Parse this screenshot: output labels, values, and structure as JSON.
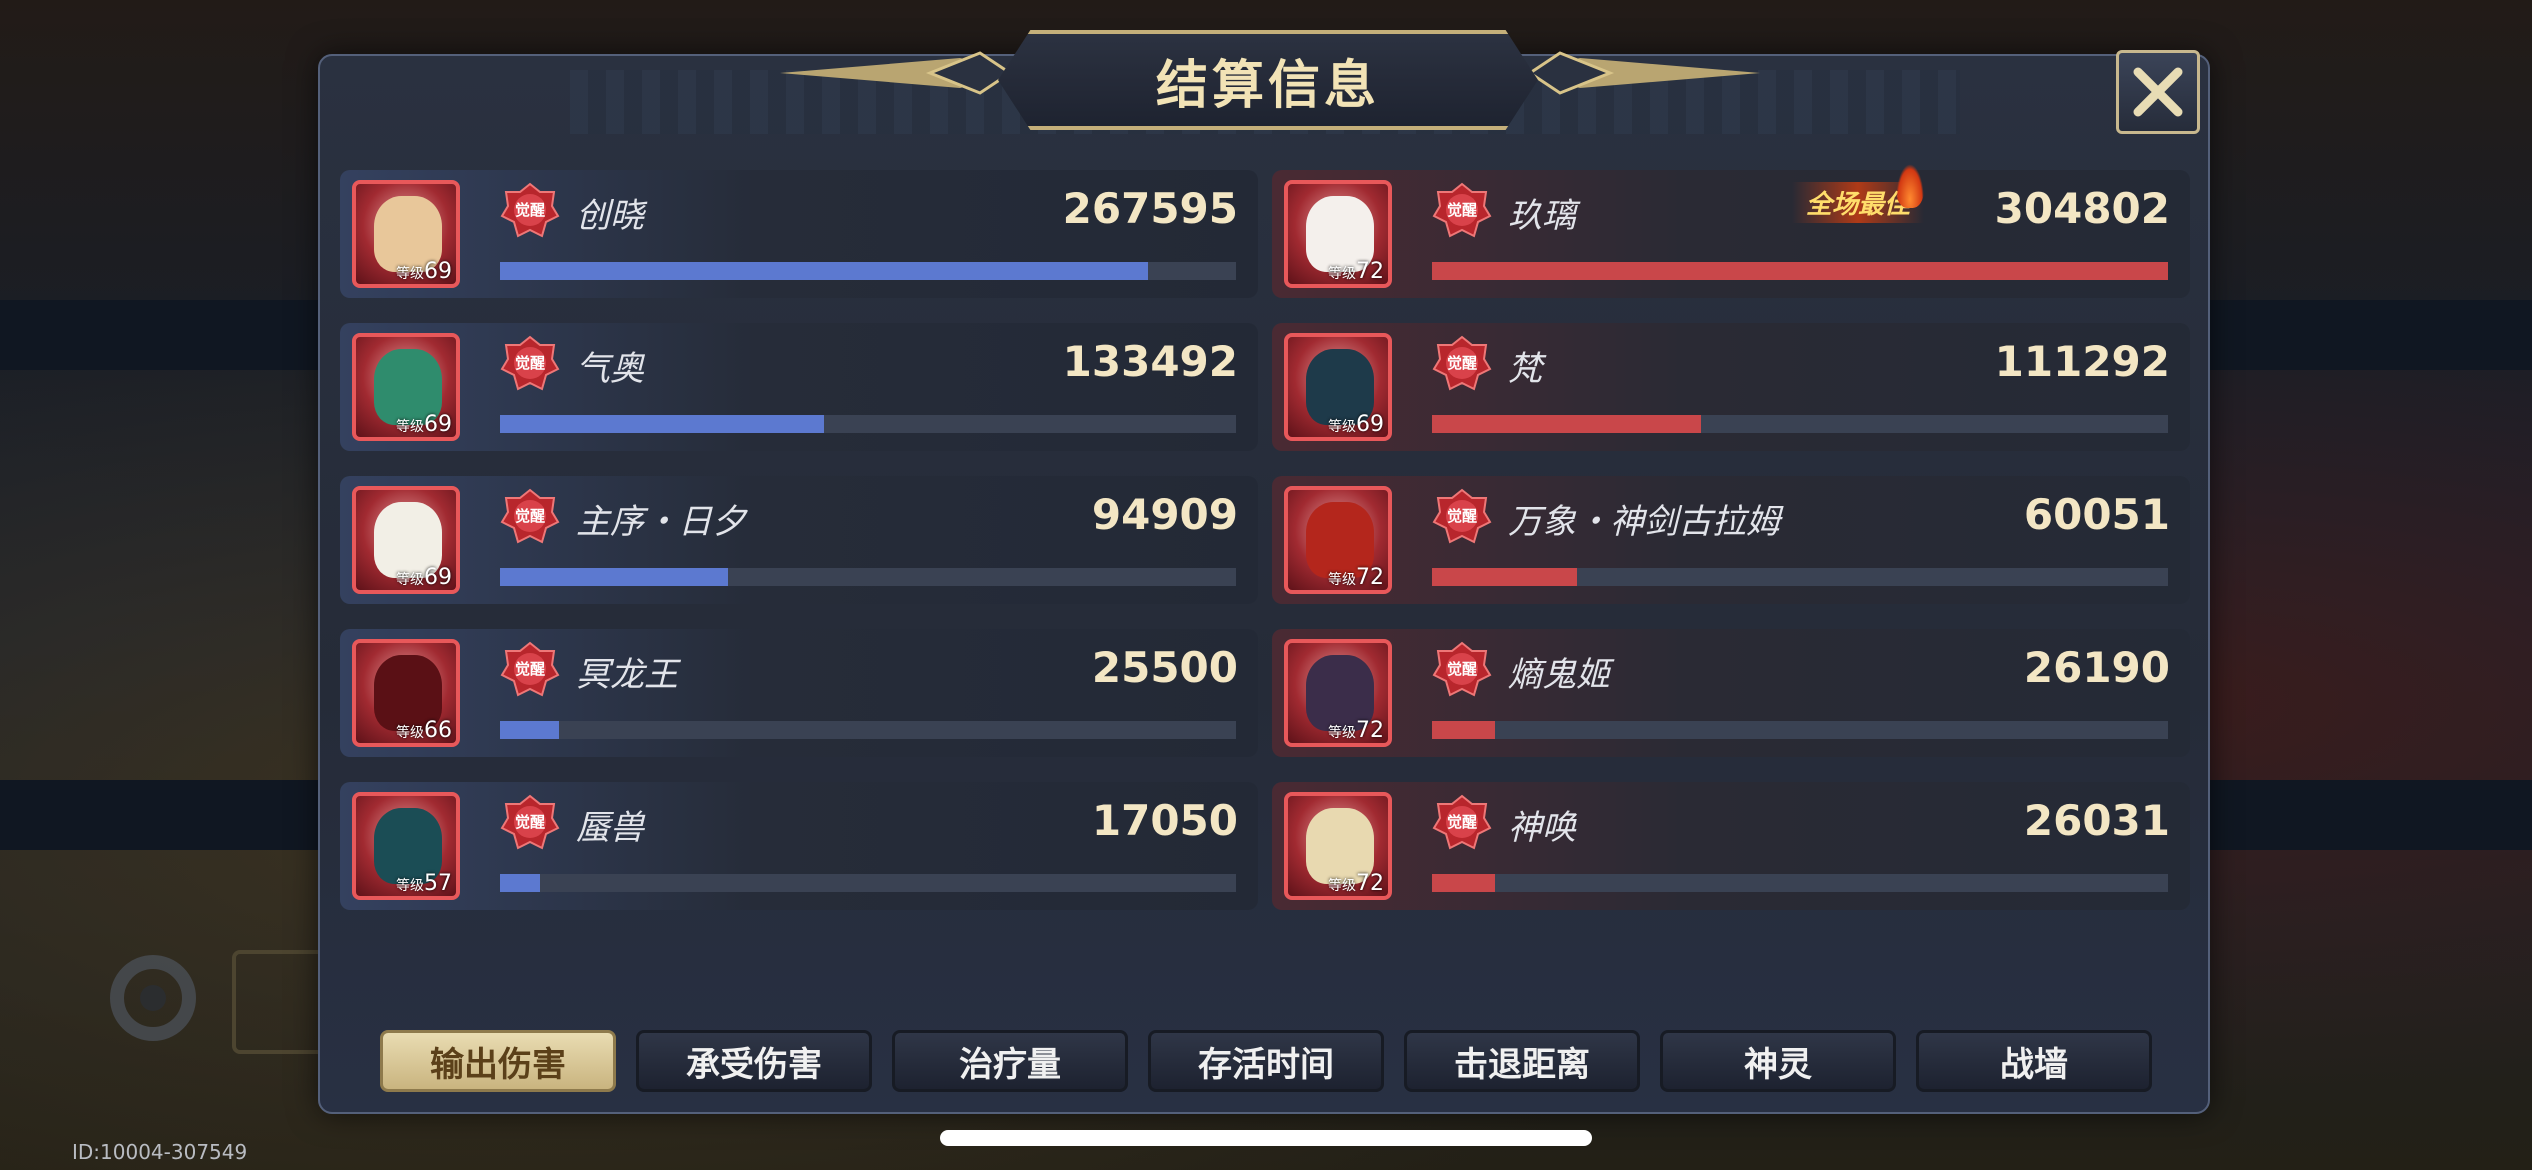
{
  "title": "结算信息",
  "best_label": "全场最佳",
  "awaken_label": "觉醒",
  "level_prefix": "等级",
  "id_text": "ID:10004-307549",
  "colors": {
    "left_bar": "#5c79d0",
    "right_bar": "#c9474a",
    "title_gold": "#f2e3b6"
  },
  "left_team": [
    {
      "name": "创晓",
      "level": "69",
      "score": "267595",
      "ratio": 0.88,
      "hero_color": "#e8c79a"
    },
    {
      "name": "气奥",
      "level": "69",
      "score": "133492",
      "ratio": 0.44,
      "hero_color": "#2f8c6d"
    },
    {
      "name": "主序・日夕",
      "level": "69",
      "score": "94909",
      "ratio": 0.31,
      "hero_color": "#f2efe6"
    },
    {
      "name": "冥龙王",
      "level": "66",
      "score": "25500",
      "ratio": 0.08,
      "hero_color": "#5a1015"
    },
    {
      "name": "蜃兽",
      "level": "57",
      "score": "17050",
      "ratio": 0.055,
      "hero_color": "#1b4d55"
    }
  ],
  "right_team": [
    {
      "name": "玖璃",
      "level": "72",
      "score": "304802",
      "ratio": 1.0,
      "best": true,
      "hero_color": "#f4f0ec"
    },
    {
      "name": "梵",
      "level": "69",
      "score": "111292",
      "ratio": 0.365,
      "hero_color": "#1e3a4a"
    },
    {
      "name": "万象・神剑古拉姆",
      "level": "72",
      "score": "60051",
      "ratio": 0.197,
      "hero_color": "#b4261c"
    },
    {
      "name": "熵鬼姬",
      "level": "72",
      "score": "26190",
      "ratio": 0.086,
      "hero_color": "#3b2d4a"
    },
    {
      "name": "神唤",
      "level": "72",
      "score": "26031",
      "ratio": 0.085,
      "hero_color": "#e8d9b0"
    }
  ],
  "tabs": [
    {
      "label": "输出伤害",
      "active": true
    },
    {
      "label": "承受伤害"
    },
    {
      "label": "治疗量"
    },
    {
      "label": "存活时间"
    },
    {
      "label": "击退距离"
    },
    {
      "label": "神灵"
    },
    {
      "label": "战墙"
    }
  ]
}
